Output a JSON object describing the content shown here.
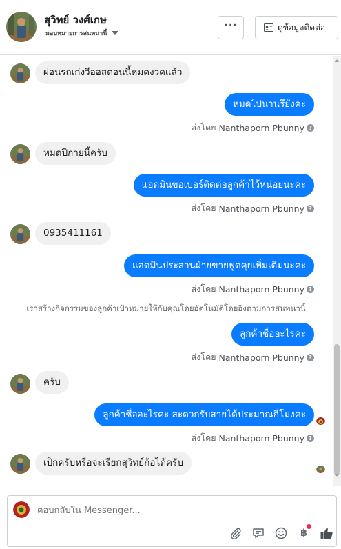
{
  "header": {
    "name": "สุวิทย์ วงศ์เกษ",
    "assignment": "มอบหมายการสนทนานี้",
    "more_label": "···",
    "contact_button": "ดูข้อมูลติดต่อ"
  },
  "messages": [
    {
      "direction": "in",
      "text": "ผ่อนรถเก่งวีออสตอนนี้หมดงวดแล้ว"
    },
    {
      "direction": "out",
      "text": "หมดไปนานรึยังคะ",
      "sent_by": "ส่งโดย",
      "sender": "Nanthaporn Pbunny"
    },
    {
      "direction": "in",
      "text": "หมดปีกายนี้ครับ"
    },
    {
      "direction": "out",
      "text": "แอดมินขอเบอร์ติดต่อลูกค้าไว้หน่อยนะคะ",
      "sent_by": "ส่งโดย",
      "sender": "Nanthaporn Pbunny"
    },
    {
      "direction": "in",
      "text": "0935411161"
    },
    {
      "direction": "out",
      "text": "แอดมินประสานฝ่ายขายพูดคุยเพิ่มเติมนะคะ",
      "sent_by": "ส่งโดย",
      "sender": "Nanthaporn Pbunny"
    },
    {
      "direction": "notice",
      "text": "เราสร้างกิจกรรมของลูกค้าเป้าหมายให้กับคุณโดยอัตโนมัติโดยอิงตามการสนทนานี้"
    },
    {
      "direction": "out",
      "text": "ลูกค้าชื่ออะไรคะ",
      "sent_by": "ส่งโดย",
      "sender": "Nanthaporn Pbunny"
    },
    {
      "direction": "in",
      "text": "ครับ"
    },
    {
      "direction": "out",
      "text": "ลูกค้าชื่ออะไรคะ สะดวกรับสายได้ประมาณกี่โมงคะ",
      "sent_by": "ส่งโดย",
      "sender": "Nanthaporn Pbunny"
    },
    {
      "direction": "in",
      "text": "เป็กครับหรือจะเรียกสุวิทย์ก้อได้ครับ"
    }
  ],
  "composer": {
    "placeholder": "ตอบกลับใน Messenger...",
    "icons": [
      "paperclip-icon",
      "chat-bubble-icon",
      "emoji-icon",
      "baht-icon",
      "thumbs-up-icon"
    ],
    "baht_glyph": "฿"
  },
  "colors": {
    "outgoing_bubble": "#0a7cff",
    "incoming_bubble": "#f0f0f0",
    "notification_dot": "#f02849"
  }
}
